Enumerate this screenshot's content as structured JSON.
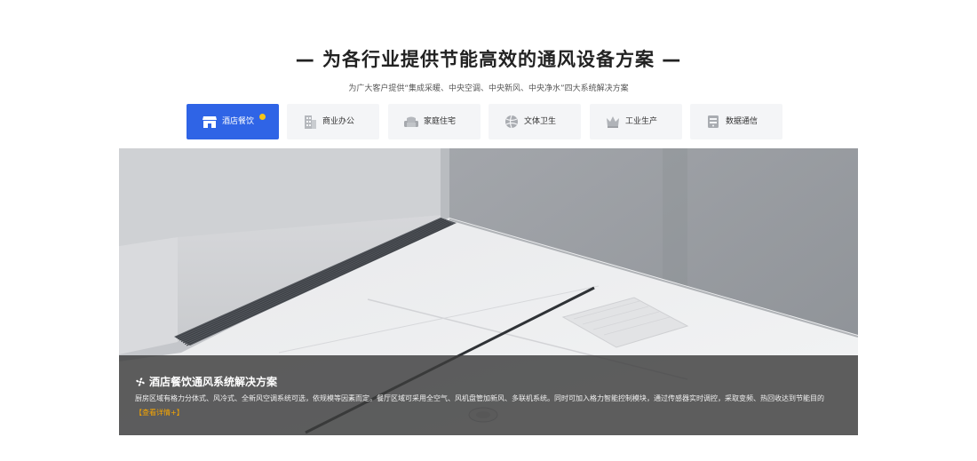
{
  "header": {
    "title": "— 为各行业提供节能高效的通风设备方案 —",
    "subtitle": "为广大客户提供“集成采暖、中央空调、中央新风、中央净水”四大系统解决方案"
  },
  "tabs": [
    {
      "label": "酒店餐饮",
      "icon": "store-icon",
      "active": true
    },
    {
      "label": "商业办公",
      "icon": "office-building-icon",
      "active": false
    },
    {
      "label": "家庭住宅",
      "icon": "sofa-icon",
      "active": false
    },
    {
      "label": "文体卫生",
      "icon": "ball-icon",
      "active": false
    },
    {
      "label": "工业生产",
      "icon": "crown-icon",
      "active": false
    },
    {
      "label": "数据通信",
      "icon": "server-icon",
      "active": false
    }
  ],
  "colors": {
    "accent": "#2f64e6",
    "badge": "#f5c518",
    "link": "#f7a600"
  },
  "hero": {
    "image": "ceiling-air-vent-photo",
    "title": "酒店餐饮通风系统解决方案",
    "description": "厨房区域有格力分体式、风冷式、全新风空调系统可选，依规模等因素而定。餐厅区域可采用全空气、风机盘管加新风、多联机系统。同时可加入格力智能控制模块，通过传感器实时调控，采取变频、热回收达到节能目的",
    "link_label": "【查看详情+】"
  }
}
